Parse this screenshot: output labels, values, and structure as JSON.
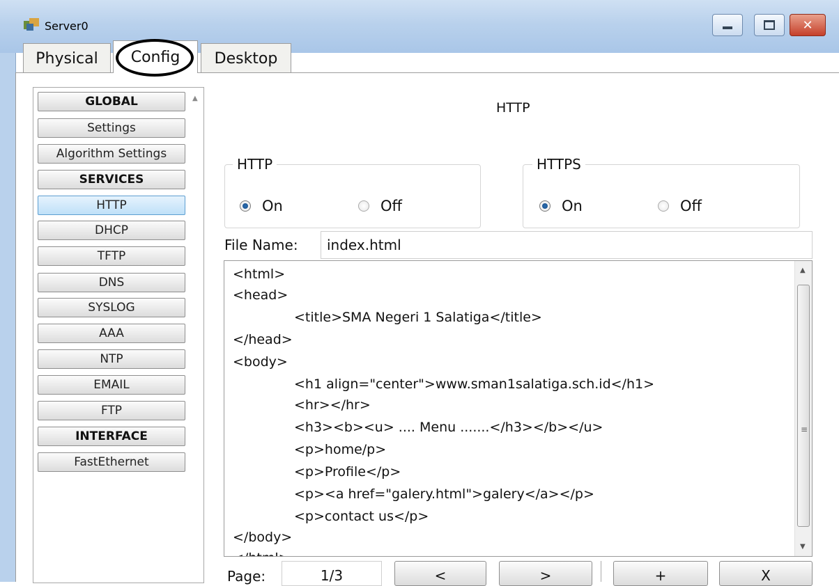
{
  "window": {
    "title": "Server0",
    "icon": "server-icon",
    "controls": [
      "minimize-icon",
      "maximize-icon",
      "close-icon"
    ]
  },
  "tabs": [
    {
      "label": "Physical",
      "selected": false
    },
    {
      "label": "Config",
      "selected": true
    },
    {
      "label": "Desktop",
      "selected": false
    }
  ],
  "sidebar": {
    "items": [
      {
        "label": "GLOBAL",
        "type": "header"
      },
      {
        "label": "Settings",
        "type": "item"
      },
      {
        "label": "Algorithm Settings",
        "type": "item"
      },
      {
        "label": "SERVICES",
        "type": "header"
      },
      {
        "label": "HTTP",
        "type": "item",
        "active": true
      },
      {
        "label": "DHCP",
        "type": "item"
      },
      {
        "label": "TFTP",
        "type": "item"
      },
      {
        "label": "DNS",
        "type": "item"
      },
      {
        "label": "SYSLOG",
        "type": "item"
      },
      {
        "label": "AAA",
        "type": "item"
      },
      {
        "label": "NTP",
        "type": "item"
      },
      {
        "label": "EMAIL",
        "type": "item"
      },
      {
        "label": "FTP",
        "type": "item"
      },
      {
        "label": "INTERFACE",
        "type": "header"
      },
      {
        "label": "FastEthernet",
        "type": "item"
      }
    ]
  },
  "content": {
    "title": "HTTP",
    "http_group": {
      "legend": "HTTP",
      "on_label": "On",
      "off_label": "Off",
      "value": "On"
    },
    "https_group": {
      "legend": "HTTPS",
      "on_label": "On",
      "off_label": "Off",
      "value": "On"
    },
    "file_name_label": "File Name:",
    "file_name_value": "index.html",
    "code_lines": [
      "<html>",
      "<head>",
      "<title>SMA Negeri 1 Salatiga</title>",
      "</head>",
      "<body>",
      "<h1 align=\"center\">www.sman1salatiga.sch.id</h1>",
      "<hr></hr>",
      "<h3><b><u> .... Menu .......</h3></b></u>",
      "<p>home/p>",
      "<p>Profile</p>",
      "<p><a href=\"galery.html\">galery</a></p>",
      "<p>contact us</p>",
      "</body>",
      "</html>"
    ],
    "page_label": "Page:",
    "page_value": "1/3",
    "prev_label": "<",
    "next_label": ">",
    "add_label": "+",
    "delete_label": "X"
  },
  "colors": {
    "titlebar": "#b9d1ec",
    "active_item": "#bfe0f8",
    "close_button": "#c5402a"
  }
}
